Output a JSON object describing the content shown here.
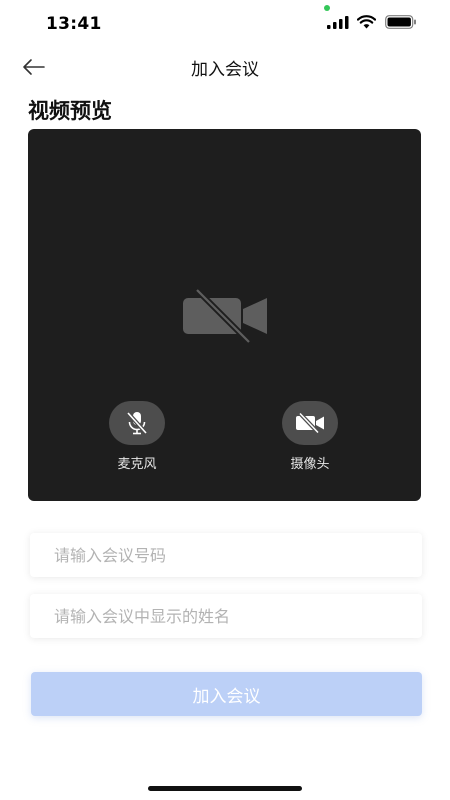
{
  "status_bar": {
    "time": "13:41",
    "icons": [
      "signal-icon",
      "wifi-icon",
      "battery-icon"
    ]
  },
  "nav": {
    "title": "加入会议",
    "back_icon": "back-arrow-icon"
  },
  "preview": {
    "section_title": "视频预览",
    "center_icon": "camera-off-icon",
    "controls": [
      {
        "label": "麦克风",
        "icon": "mic-off-icon"
      },
      {
        "label": "摄像头",
        "icon": "camera-off-icon"
      }
    ]
  },
  "form": {
    "meeting_number_placeholder": "请输入会议号码",
    "display_name_placeholder": "请输入会议中显示的姓名",
    "meeting_number_value": "",
    "display_name_value": ""
  },
  "join_button_label": "加入会议",
  "colors": {
    "preview_bg": "#1e1e1e",
    "control_bg": "#4d4d4d",
    "join_button_bg": "#bcd0f7",
    "status_dot": "#34c759"
  }
}
